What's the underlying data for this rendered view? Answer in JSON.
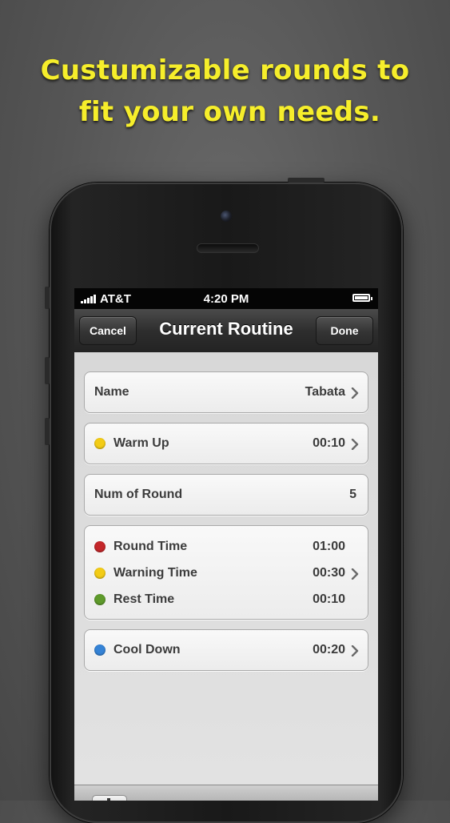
{
  "headline": {
    "line1": "Custumizable rounds to",
    "line2": "fit your own needs."
  },
  "colors": {
    "headline": "#f6ee2b",
    "yellow": "#f3cc16",
    "red": "#c4272a",
    "green": "#5e9a2b",
    "blue": "#3583d6"
  },
  "status_bar": {
    "carrier": "AT&T",
    "time": "4:20 PM",
    "battery_icon": "battery-icon",
    "signal_icon": "signal-icon"
  },
  "nav": {
    "cancel_label": "Cancel",
    "title": "Current Routine",
    "done_label": "Done"
  },
  "routine": {
    "name": {
      "label": "Name",
      "value": "Tabata"
    },
    "warm_up": {
      "label": "Warm Up",
      "value": "00:10",
      "color": "yellow"
    },
    "num_rounds": {
      "label": "Num of Round",
      "value": "5"
    },
    "intervals": [
      {
        "label": "Round Time",
        "value": "01:00",
        "color": "red"
      },
      {
        "label": "Warning Time",
        "value": "00:30",
        "color": "yellow"
      },
      {
        "label": "Rest Time",
        "value": "00:10",
        "color": "green"
      }
    ],
    "cool_down": {
      "label": "Cool Down",
      "value": "00:20",
      "color": "blue"
    }
  }
}
